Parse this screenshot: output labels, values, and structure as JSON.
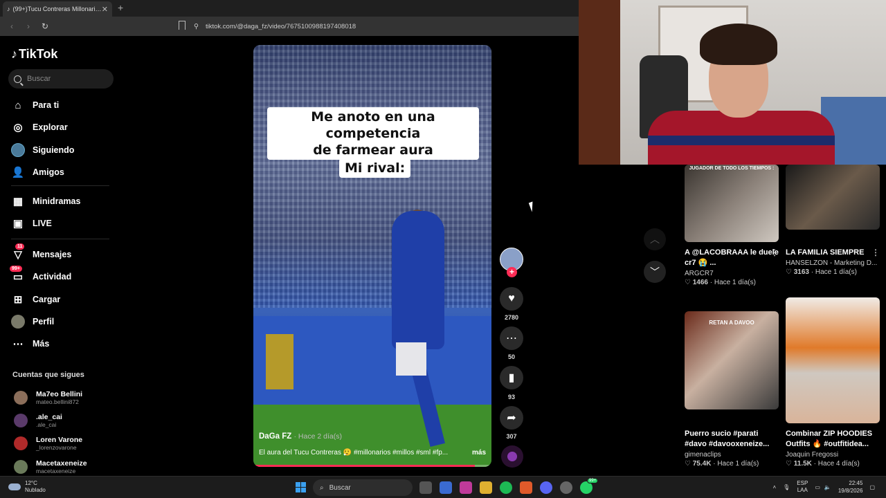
{
  "browser": {
    "tab_title": "(99+)Tucu Contreras Millonarios",
    "url": "tiktok.com/@daga_fz/video/7675100988197408018"
  },
  "tiktok": {
    "logo_text": "TikTok",
    "search_placeholder": "Buscar",
    "nav": [
      {
        "label": "Para ti",
        "icon": "home-icon"
      },
      {
        "label": "Explorar",
        "icon": "compass-icon"
      },
      {
        "label": "Siguiendo",
        "icon": "following-avatar-icon"
      },
      {
        "label": "Amigos",
        "icon": "friends-icon"
      },
      {
        "label": "Minidramas",
        "icon": "minidramas-icon"
      },
      {
        "label": "LIVE",
        "icon": "live-tv-icon"
      },
      {
        "label": "Mensajes",
        "icon": "messages-icon",
        "badge": "11"
      },
      {
        "label": "Actividad",
        "icon": "activity-icon",
        "badge": "99+"
      },
      {
        "label": "Cargar",
        "icon": "upload-icon"
      },
      {
        "label": "Perfil",
        "icon": "profile-avatar-icon"
      },
      {
        "label": "Más",
        "icon": "more-icon"
      }
    ],
    "following_title": "Cuentas que sigues",
    "following": [
      {
        "name": "Ma7eo Bellini",
        "handle": "mateo.bellini872"
      },
      {
        "name": ".ale_cai",
        "handle": ".ale_cai"
      },
      {
        "name": "Loren Varone",
        "handle": "_lorenzovarone"
      },
      {
        "name": "Macetaxeneize",
        "handle": "macetaxeneize"
      }
    ]
  },
  "video": {
    "caption_line1": "Me anoto en una competencia",
    "caption_line2": "de farmear aura",
    "caption_line3": "Mi rival:",
    "author": "DaGa FZ",
    "time": "· Hace 2 día(s)",
    "description": "El aura del Tucu Contreras 😮‍💨 #millonarios #millos #sml #fp...",
    "more": "más",
    "progress": 0.93,
    "likes": "2780",
    "comments": "50",
    "saves": "93",
    "shares": "307"
  },
  "recommended": [
    {
      "title": "A @LACOBRAAA le duele cr7 😭 ...",
      "author": "ARGCR7",
      "likes": "1466",
      "time": "· Hace 1 día(s)",
      "label": "JUGADOR DE TODO LOS TIEMPOS :"
    },
    {
      "title": "LA FAMILIA SIEMPRE",
      "author": "HANSELZON - Marketing D...",
      "likes": "3163",
      "time": "· Hace 1 día(s)",
      "label": ""
    },
    {
      "title": "Puerro sucio #parati #davo #davooxeneize...",
      "author": "gimenaclips",
      "likes": "75.4K",
      "time": "· Hace 1 día(s)",
      "label": "RETAN A DAVOO"
    },
    {
      "title": "Combinar ZIP HOODIES Outfits 🔥 #outfitidea...",
      "author": "Joaquin Fregossi",
      "likes": "11.5K",
      "time": "· Hace 4 día(s)",
      "label": ""
    }
  ],
  "taskbar": {
    "temp": "12°C",
    "weather": "Nublado",
    "search": "Buscar",
    "lang1": "ESP",
    "lang2": "LAA",
    "time": "22:45",
    "date": "19/8/2026",
    "whatsapp_badge": "99+"
  }
}
